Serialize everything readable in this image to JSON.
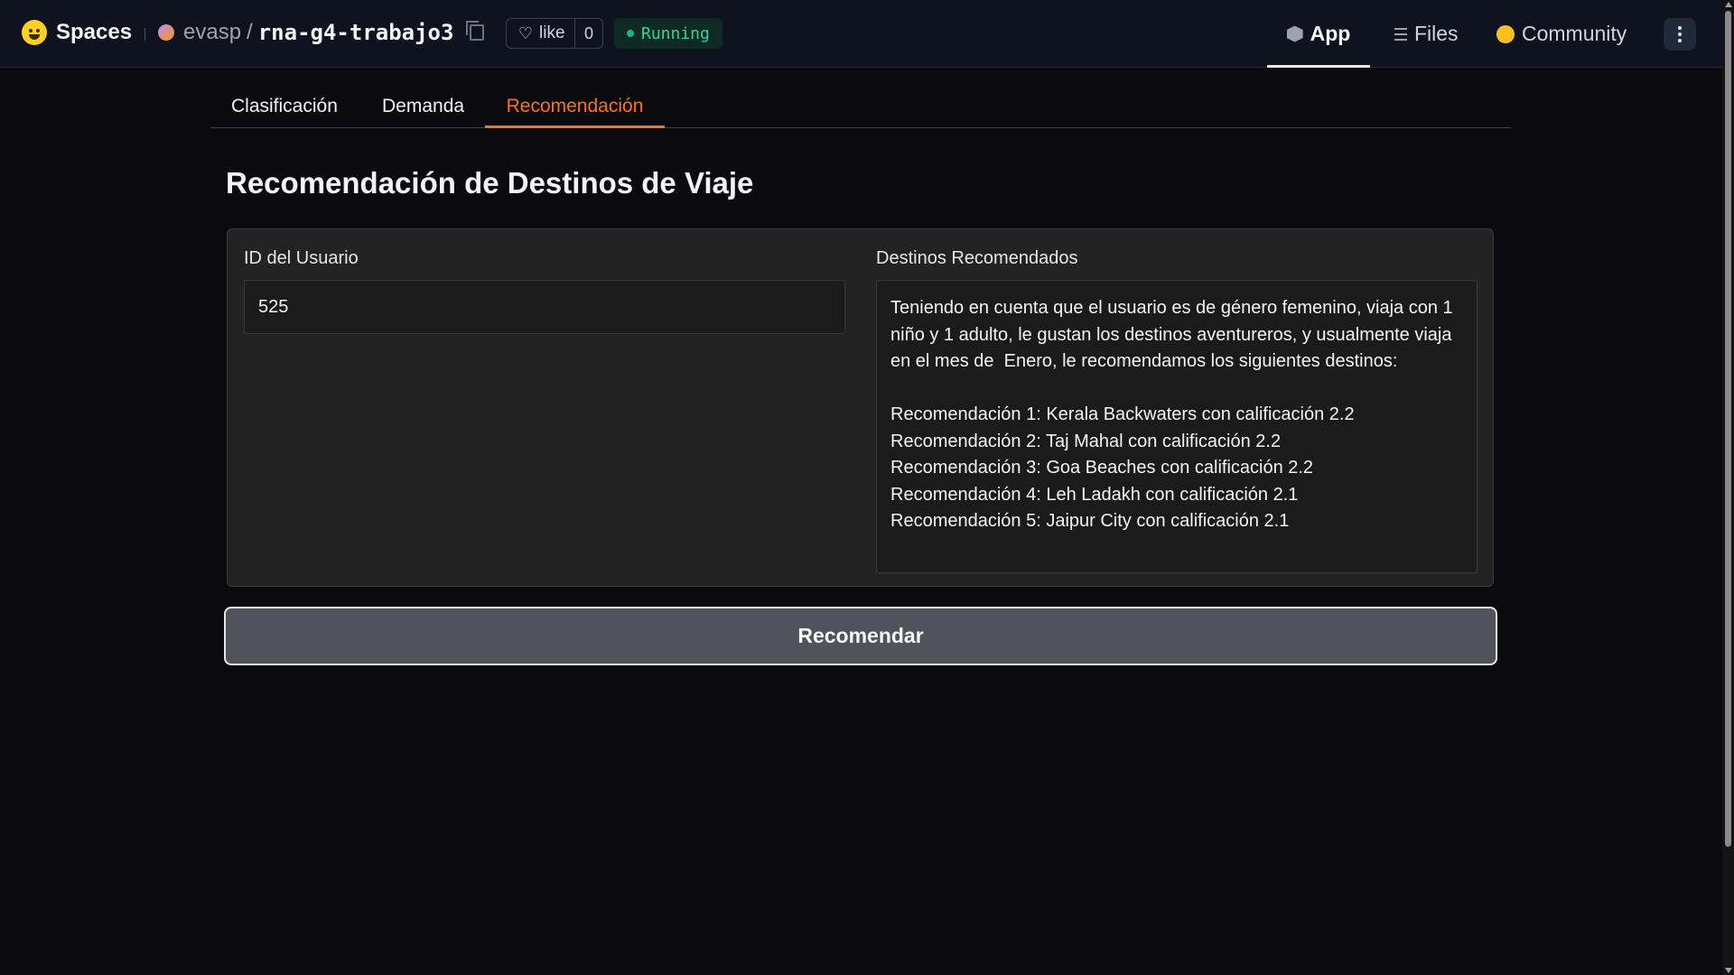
{
  "header": {
    "brand": "Spaces",
    "owner": "evasp",
    "separator": "/",
    "space_name": "rna-g4-trabajo3",
    "like_label": "like",
    "like_count": "0",
    "status": "Running",
    "nav": {
      "app": "App",
      "files": "Files",
      "community": "Community"
    }
  },
  "tabs": [
    {
      "label": "Clasificación",
      "active": false
    },
    {
      "label": "Demanda",
      "active": false
    },
    {
      "label": "Recomendación",
      "active": true
    }
  ],
  "main": {
    "title": "Recomendación de Destinos de Viaje",
    "input": {
      "label": "ID del Usuario",
      "value": "525"
    },
    "output": {
      "label": "Destinos Recomendados",
      "text": "Teniendo en cuenta que el usuario es de género femenino, viaja con 1 niño y 1 adulto, le gustan los destinos aventureros, y usualmente viaja en el mes de  Enero, le recomendamos los siguientes destinos:\n\nRecomendación 1: Kerala Backwaters con calificación 2.2\nRecomendación 2: Taj Mahal con calificación 2.2\nRecomendación 3: Goa Beaches con calificación 2.2\nRecomendación 4: Leh Ladakh con calificación 2.1\nRecomendación 5: Jaipur City con calificación 2.1"
    },
    "button": "Recomendar"
  },
  "colors": {
    "accent": "#f97316",
    "status": "#34d399",
    "background": "#0b0b0f"
  },
  "icons": [
    "huggingface-logo-icon",
    "copy-icon",
    "heart-icon",
    "cube-icon",
    "files-icon",
    "community-icon",
    "more-vertical-icon"
  ]
}
